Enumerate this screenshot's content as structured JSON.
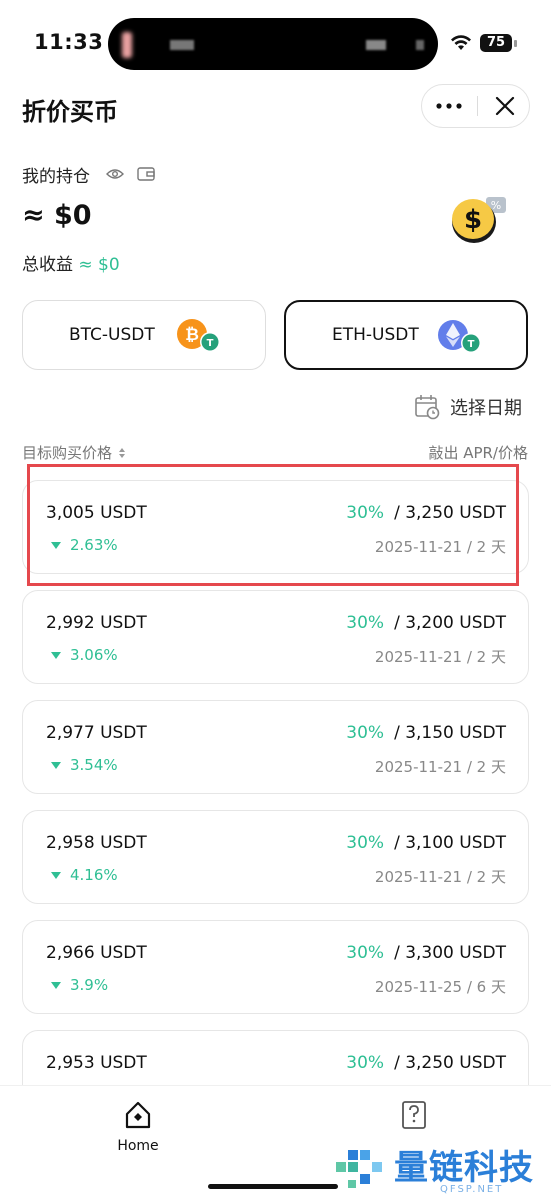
{
  "status": {
    "time": "11:33",
    "battery": "75"
  },
  "header": {
    "title": "折价买币"
  },
  "holdings": {
    "label": "我的持仓",
    "value": "≈ $0",
    "pnl_label": "总收益",
    "pnl_value": "≈ $0"
  },
  "pairs": [
    {
      "label": "BTC-USDT",
      "selected": false
    },
    {
      "label": "ETH-USDT",
      "selected": true
    }
  ],
  "date_select": "选择日期",
  "columns": {
    "left": "目标购买价格",
    "right": "敲出 APR/价格"
  },
  "products": [
    {
      "price": "3,005 USDT",
      "pct": "2.63%",
      "apr": "30%",
      "target": "/ 3,250 USDT",
      "date": "2025-11-21 / 2 天"
    },
    {
      "price": "2,992 USDT",
      "pct": "3.06%",
      "apr": "30%",
      "target": "/ 3,200 USDT",
      "date": "2025-11-21 / 2 天"
    },
    {
      "price": "2,977 USDT",
      "pct": "3.54%",
      "apr": "30%",
      "target": "/ 3,150 USDT",
      "date": "2025-11-21 / 2 天"
    },
    {
      "price": "2,958 USDT",
      "pct": "4.16%",
      "apr": "30%",
      "target": "/ 3,100 USDT",
      "date": "2025-11-21 / 2 天"
    },
    {
      "price": "2,966 USDT",
      "pct": "3.9%",
      "apr": "30%",
      "target": "/ 3,300 USDT",
      "date": "2025-11-25 / 6 天"
    },
    {
      "price": "2,953 USDT",
      "pct": "",
      "apr": "30%",
      "target": "/ 3,250 USDT",
      "date": ""
    }
  ],
  "nav": {
    "home": "Home"
  },
  "watermark": {
    "text": "量链科技",
    "sub": "QFSP.NET"
  },
  "colors": {
    "accent_green": "#2fbf94",
    "highlight_red": "#e5484d",
    "watermark_blue": "#2b7fd8"
  },
  "icons": [
    "wifi-icon",
    "battery-icon",
    "more-icon",
    "close-icon",
    "eye-icon",
    "wallet-icon",
    "dollar-coin-icon",
    "btc-icon",
    "eth-icon",
    "usdt-icon",
    "calendar-icon",
    "sort-icon",
    "home-icon",
    "faq-icon"
  ]
}
